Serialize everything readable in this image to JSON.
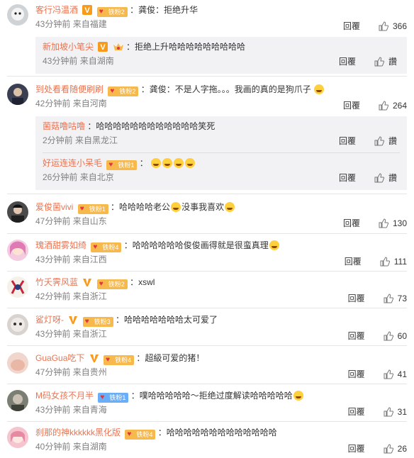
{
  "actions": {
    "reply_label": "回覆",
    "like_icon": "thumbs-up-icon"
  },
  "comments": [
    {
      "nick": "客行冯温酒",
      "fan": "铁粉2",
      "text": "：龚俊：拒绝升华",
      "time": "43分钟前",
      "src": "来自福建",
      "likes": "366"
    },
    {
      "nick": "新加坡小笔尖",
      "fan": "",
      "text": "：拒绝上升哈哈哈哈哈哈哈哈哈",
      "time": "43分钟前",
      "src": "来自湖南",
      "likes": "讚"
    },
    {
      "nick": "到处看看随便刷刷",
      "fan": "铁粉2",
      "text": "：龚俊：不是人字拖。。。我画的真的是狗爪子",
      "time": "42分钟前",
      "src": "来自河南",
      "likes": "264"
    },
    {
      "nick": "菌菇噜咕噜",
      "fan": "",
      "text": "：哈哈哈哈哈哈哈哈哈哈哈哈笑死",
      "time": "2分钟前",
      "src": "来自黑龙江",
      "likes": "讚"
    },
    {
      "nick": "好运连连小呆毛",
      "fan": "铁粉1",
      "text": "：",
      "time": "26分钟前",
      "src": "来自北京",
      "likes": "讚"
    },
    {
      "nick": "爱俊菌vivi",
      "fan": "铁粉1",
      "text": "：哈哈哈哈老公",
      "text2": "没事我喜欢",
      "time": "47分钟前",
      "src": "来自山东",
      "likes": "130"
    },
    {
      "nick": "瑰酒甜雾如绮",
      "fan": "铁粉4",
      "text": "：哈哈哈哈哈哈俊俊画得就是很蛮真理",
      "time": "43分钟前",
      "src": "来自江西",
      "likes": "111"
    },
    {
      "nick": "竹夭霁风蓝",
      "fan": "铁粉2",
      "text": "：xswl",
      "time": "42分钟前",
      "src": "来自浙江",
      "likes": "73"
    },
    {
      "nick": "鲨灯呀-",
      "fan": "铁粉3",
      "text": "：哈哈哈哈哈哈哈太可爱了",
      "time": "43分钟前",
      "src": "来自浙江",
      "likes": "60"
    },
    {
      "nick": "GuaGua吃下",
      "fan": "铁粉4",
      "text": "：超級可爱的猪！",
      "time": "47分钟前",
      "src": "来自贵州",
      "likes": "41"
    },
    {
      "nick": "M码女孩不月半",
      "fan": "铁粉1",
      "text": "：噗哈哈哈哈哈～拒绝过度解读哈哈哈哈哈",
      "time": "43分钟前",
      "src": "来自青海",
      "likes": "31"
    },
    {
      "nick": "刹那的神kkkkkk黑化版",
      "fan": "铁粉4",
      "text": "：哈哈哈哈哈哈哈哈哈哈哈哈哈",
      "time": "40分钟前",
      "src": "来自湖南",
      "likes": "26"
    }
  ]
}
